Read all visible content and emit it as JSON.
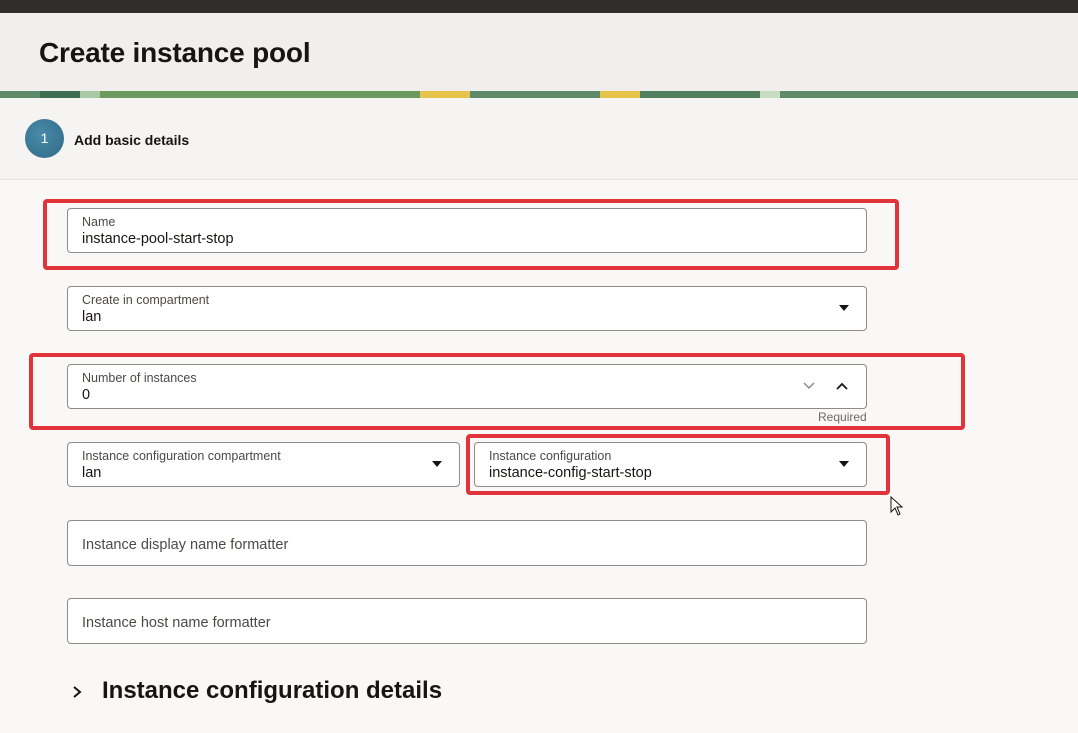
{
  "page": {
    "title": "Create instance pool"
  },
  "step": {
    "number": "1",
    "label": "Add basic details"
  },
  "form": {
    "name": {
      "label": "Name",
      "value": "instance-pool-start-stop"
    },
    "compartment": {
      "label": "Create in compartment",
      "value": "lan"
    },
    "instances": {
      "label": "Number of instances",
      "value": "0",
      "helper": "Required"
    },
    "config_compartment": {
      "label": "Instance configuration compartment",
      "value": "lan"
    },
    "config": {
      "label": "Instance configuration",
      "value": "instance-config-start-stop"
    },
    "display_name_formatter": {
      "placeholder": "Instance display name formatter"
    },
    "host_name_formatter": {
      "placeholder": "Instance host name formatter"
    }
  },
  "section": {
    "title": "Instance configuration details"
  },
  "colors": {
    "highlight": "#e0343a",
    "topbar": "#312d2a",
    "step_accent": "#2d6a86"
  }
}
